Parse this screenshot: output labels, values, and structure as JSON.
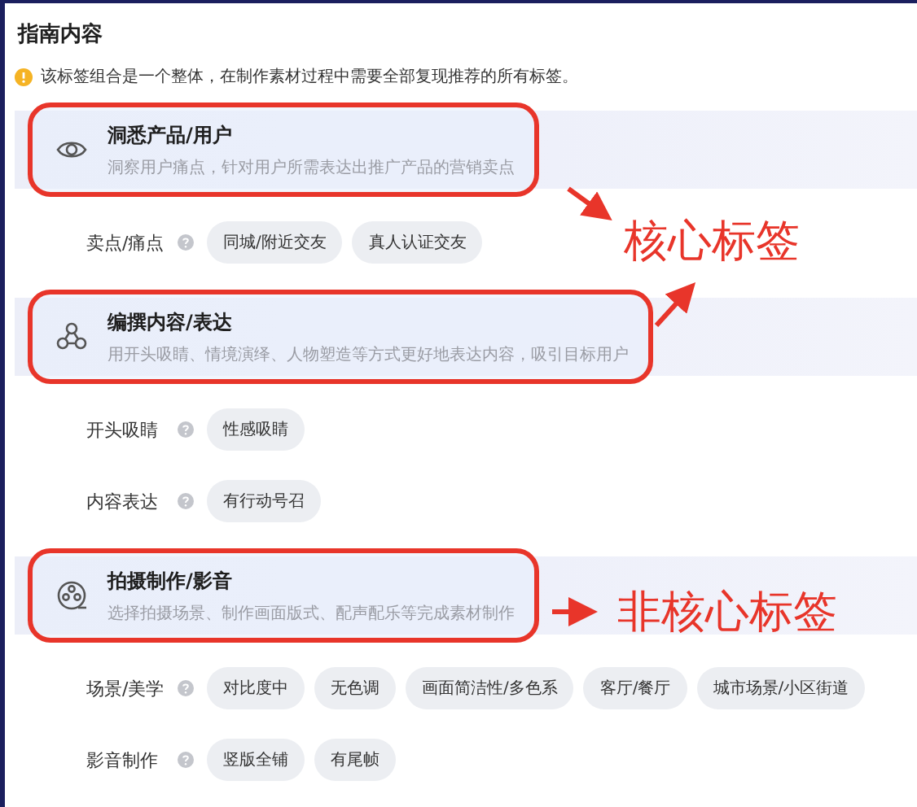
{
  "title": "指南内容",
  "notice": "该标签组合是一个整体，在制作素材过程中需要全部复现推荐的所有标签。",
  "sections": [
    {
      "kind": "insight",
      "title": "洞悉产品/用户",
      "description": "洞察用户痛点，针对用户所需表达出推广产品的营销卖点",
      "highlighted": true,
      "rows": [
        {
          "label": "卖点/痛点",
          "tags": [
            "同城/附近交友",
            "真人认证交友"
          ]
        }
      ]
    },
    {
      "kind": "content",
      "title": "编撰内容/表达",
      "description": "用开头吸睛、情境演绎、人物塑造等方式更好地表达内容，吸引目标用户",
      "highlighted": true,
      "rows": [
        {
          "label": "开头吸睛",
          "tags": [
            "性感吸睛"
          ]
        },
        {
          "label": "内容表达",
          "tags": [
            "有行动号召"
          ]
        }
      ]
    },
    {
      "kind": "production",
      "title": "拍摄制作/影音",
      "description": "选择拍摄场景、制作画面版式、配声配乐等完成素材制作",
      "highlighted": true,
      "rows": [
        {
          "label": "场景/美学",
          "tags": [
            "对比度中",
            "无色调",
            "画面简洁性/多色系",
            "客厅/餐厅",
            "城市场景/小区街道"
          ]
        },
        {
          "label": "影音制作",
          "tags": [
            "竖版全铺",
            "有尾帧"
          ]
        }
      ]
    }
  ],
  "callouts": [
    {
      "label": "核心标签"
    },
    {
      "label": "非核心标签"
    }
  ]
}
